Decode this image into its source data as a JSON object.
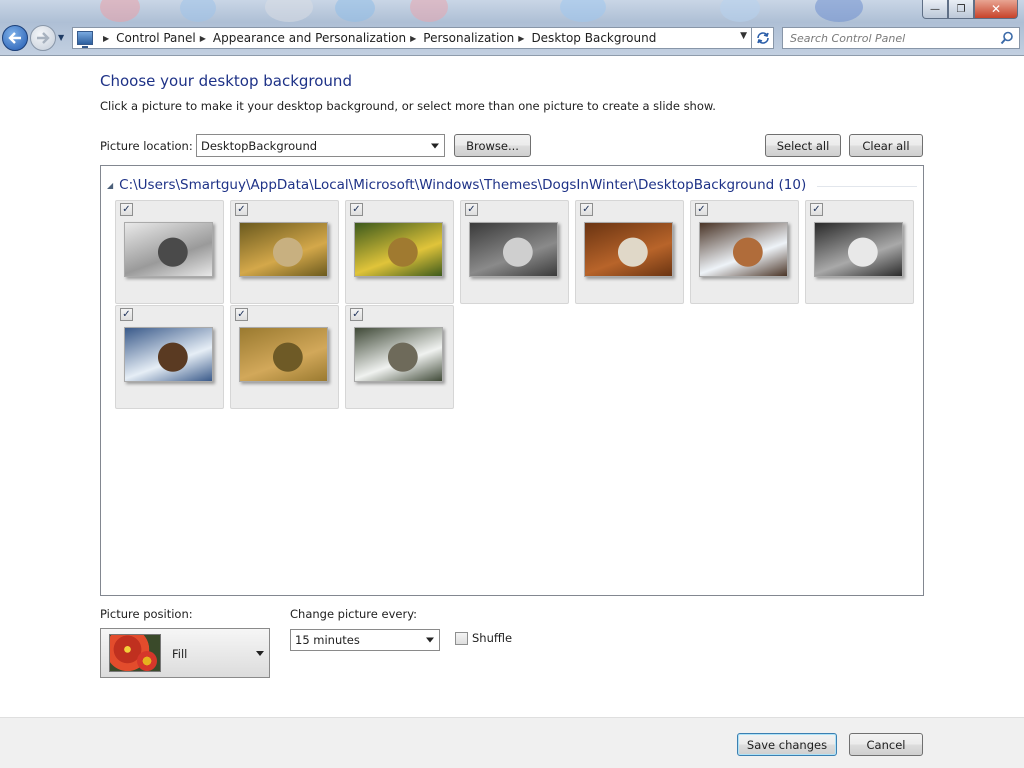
{
  "window": {
    "controls": {
      "minimize": "—",
      "restore": "❐",
      "close": "✕"
    }
  },
  "nav": {
    "back_icon": "arrow-left-icon",
    "forward_icon": "arrow-right-icon",
    "breadcrumbs": [
      "Control Panel",
      "Appearance and Personalization",
      "Personalization",
      "Desktop Background"
    ],
    "search_placeholder": "Search Control Panel"
  },
  "main": {
    "title": "Choose your desktop background",
    "subtitle": "Click a picture to make it your desktop background, or select more than one picture to create a slide show.",
    "location_label": "Picture location:",
    "location_value": "DesktopBackground",
    "browse_label": "Browse...",
    "select_all_label": "Select all",
    "clear_all_label": "Clear all",
    "group_path": "C:\\Users\\Smartguy\\AppData\\Local\\Microsoft\\Windows\\Themes\\DogsInWinter\\DesktopBackground (10)",
    "pictures": [
      {
        "checked": true,
        "colors": [
          "#e9e9e9",
          "#9a9a9a",
          "#4a4a4a"
        ]
      },
      {
        "checked": true,
        "colors": [
          "#6b5a1e",
          "#d4a84a",
          "#c8b080"
        ]
      },
      {
        "checked": true,
        "colors": [
          "#3d5a1c",
          "#e0c43a",
          "#a07a30"
        ]
      },
      {
        "checked": true,
        "colors": [
          "#3a3a3a",
          "#8a8a8a",
          "#cfcfcf"
        ]
      },
      {
        "checked": true,
        "colors": [
          "#6a3412",
          "#b8642a",
          "#e0d8c8"
        ]
      },
      {
        "checked": true,
        "colors": [
          "#4a3426",
          "#eef3f8",
          "#b06c3a"
        ]
      },
      {
        "checked": true,
        "colors": [
          "#2a2a2a",
          "#a9a9a9",
          "#e8e8e8"
        ]
      },
      {
        "checked": true,
        "colors": [
          "#3a5a8a",
          "#e6eef6",
          "#5a3a22"
        ]
      },
      {
        "checked": true,
        "colors": [
          "#9a7a30",
          "#d2a85a",
          "#6e5a26"
        ]
      },
      {
        "checked": true,
        "colors": [
          "#404a38",
          "#f0f2f0",
          "#6e6a5a"
        ]
      }
    ]
  },
  "options": {
    "position_label": "Picture position:",
    "position_value": "Fill",
    "change_label": "Change picture every:",
    "change_value": "15 minutes",
    "shuffle_label": "Shuffle",
    "shuffle_checked": false
  },
  "footer": {
    "save_label": "Save changes",
    "cancel_label": "Cancel"
  }
}
